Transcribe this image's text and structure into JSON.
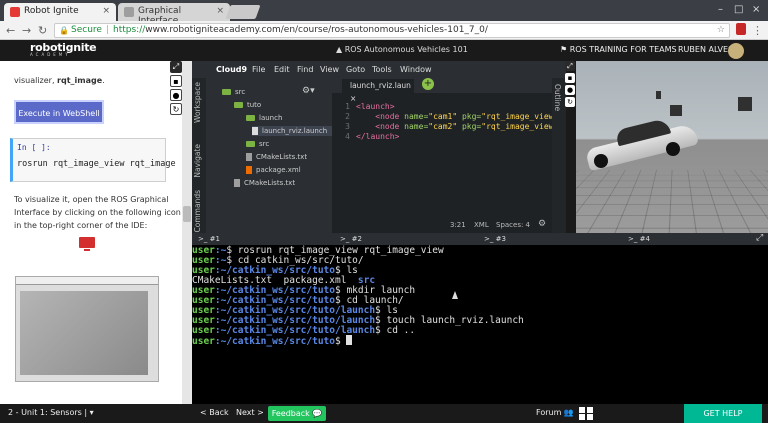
{
  "browser": {
    "tabs": [
      {
        "label": "Robot Ignite",
        "active": true,
        "close": "×",
        "favicon_color": "#e53935"
      },
      {
        "label": "Graphical Interface",
        "active": false,
        "close": "×",
        "favicon_color": "#9e9e9e"
      }
    ],
    "window_controls": [
      "–",
      "□",
      "×"
    ],
    "address": {
      "secure_label": "Secure",
      "scheme": "https://",
      "url_rest": "www.robotigniteacademy.com/en/course/ros-autonomous-vehicles-101_7_0/",
      "nav_icons": [
        "back-icon",
        "forward-icon",
        "reload-icon"
      ]
    }
  },
  "site_header": {
    "logo_main": "robotignite",
    "logo_sub": "ACADEMY",
    "course_title": "ROS Autonomous Vehicles 101",
    "training_link": "ROS TRAINING FOR TEAMS",
    "user_name": "RUBEN ALVES"
  },
  "notebook": {
    "intro_text_prefix": "visualizer, ",
    "intro_text_bold": "rqt_image",
    "intro_text_suffix": ".",
    "execute_button": "Execute in WebShell #1",
    "cell_prompt": "In [ ]:",
    "cell_code": "rosrun rqt_image_view rqt_image",
    "paragraph": [
      "To visualize it, open the ROS Graphical",
      "Interface by clicking on the following icon",
      "in the top-right corner of the IDE:"
    ]
  },
  "ide": {
    "menu": [
      "Cloud9",
      "File",
      "Edit",
      "Find",
      "View",
      "Goto",
      "Tools",
      "Window"
    ],
    "side_tabs": [
      "Workspace",
      "Navigate",
      "Commands"
    ],
    "outline_tab": "Outline",
    "tree": [
      {
        "label": "src",
        "type": "folder"
      },
      {
        "label": "tuto",
        "type": "folder"
      },
      {
        "label": "launch",
        "type": "folder"
      },
      {
        "label": "launch_rviz.launch",
        "type": "file"
      },
      {
        "label": "src",
        "type": "folder"
      },
      {
        "label": "CMakeLists.txt",
        "type": "file"
      },
      {
        "label": "package.xml",
        "type": "file"
      },
      {
        "label": "CMakeLists.txt",
        "type": "file"
      }
    ],
    "editor_tab": "launch_rviz.laun",
    "editor_tab_close": "×",
    "add_tab": "+",
    "line_numbers": [
      "1",
      "2",
      "3",
      "4"
    ],
    "code": [
      {
        "tag_open": "<launch>"
      },
      {
        "indent": "    ",
        "tag": "<node ",
        "attr1": "name=",
        "val1": "\"cam1\" ",
        "attr2": "pkg=",
        "val2": "\"rqt_image_view"
      },
      {
        "indent": "    ",
        "tag": "<node ",
        "attr1": "name=",
        "val1": "\"cam2\" ",
        "attr2": "pkg=",
        "val2": "\"rqt_image_view"
      },
      {
        "tag_open": "</launch>"
      }
    ],
    "status": {
      "position": "3:21",
      "language": "XML",
      "spaces": "Spaces: 4"
    }
  },
  "terminal": {
    "tabs": [
      ">_ #1",
      ">_ #2",
      ">_ #3",
      ">_ #4"
    ],
    "lines": [
      {
        "user": "user",
        "path": ":~",
        "cmd": "$ rosrun rqt_image_view rqt_image_view"
      },
      {
        "user": "user",
        "path": ":~",
        "cmd": "$ cd catkin_ws/src/tuto/"
      },
      {
        "user": "user",
        "path": ":~/catkin_ws/src/tuto",
        "cmd": "$ ls"
      },
      {
        "output": "CMakeLists.txt  package.xml  ",
        "output_dir": "src"
      },
      {
        "user": "user",
        "path": ":~/catkin_ws/src/tuto",
        "cmd": "$ mkdir launch"
      },
      {
        "user": "user",
        "path": ":~/catkin_ws/src/tuto",
        "cmd": "$ cd launch/"
      },
      {
        "user": "user",
        "path": ":~/catkin_ws/src/tuto/launch",
        "cmd": "$ ls"
      },
      {
        "user": "user",
        "path": ":~/catkin_ws/src/tuto/launch",
        "cmd": "$ touch launch_rviz.launch"
      },
      {
        "user": "user",
        "path": ":~/catkin_ws/src/tuto/launch",
        "cmd": "$ cd .."
      },
      {
        "user": "user",
        "path": ":~/catkin_ws/src/tuto",
        "cmd": "$ ",
        "cursor": true
      }
    ]
  },
  "bottom_bar": {
    "unit": "2 - Unit 1: Sensors |",
    "back": "< Back",
    "next": "Next >",
    "feedback": "Feedback",
    "forum": "Forum",
    "get_help": "GET HELP"
  },
  "colors": {
    "accent_green": "#22c55e",
    "execute_blue": "#5b6ac9",
    "prompt_green": "#6bd14f",
    "prompt_blue": "#5a88e6"
  }
}
